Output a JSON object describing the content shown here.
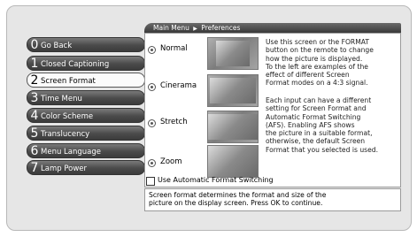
{
  "menu": {
    "items": [
      {
        "num": "0",
        "label": "Go Back"
      },
      {
        "num": "1",
        "label": "Closed Captioning"
      },
      {
        "num": "2",
        "label": "Screen Format"
      },
      {
        "num": "3",
        "label": "Time Menu"
      },
      {
        "num": "4",
        "label": "Color Scheme"
      },
      {
        "num": "5",
        "label": "Translucency"
      },
      {
        "num": "6",
        "label": "Menu Language"
      },
      {
        "num": "7",
        "label": "Lamp Power"
      }
    ]
  },
  "breadcrumb": {
    "root": "Main Menu",
    "arrow": "▶",
    "current": "Preferences"
  },
  "options": [
    {
      "label": "Normal"
    },
    {
      "label": "Cinerama"
    },
    {
      "label": "Stretch"
    },
    {
      "label": "Zoom"
    }
  ],
  "help": {
    "para1": [
      "Use this screen or the FORMAT",
      "button on the remote to change",
      "how the picture is displayed.",
      "To the left are examples of the",
      "effect of different Screen",
      "Format modes on a 4:3 signal."
    ],
    "para2": [
      "Each input can have a different",
      "setting for Screen Format and",
      "Automatic Format Switching",
      "(AFS). Enabling AFS shows",
      "the picture in a suitable format,",
      "otherwise, the default Screen",
      "Format that you selected is used."
    ]
  },
  "checkbox": {
    "label": "Use Automatic Format Switching",
    "checked": false
  },
  "status": {
    "line1": "Screen format determines the format and size of the",
    "line2": "picture on the display screen. Press OK to continue."
  }
}
